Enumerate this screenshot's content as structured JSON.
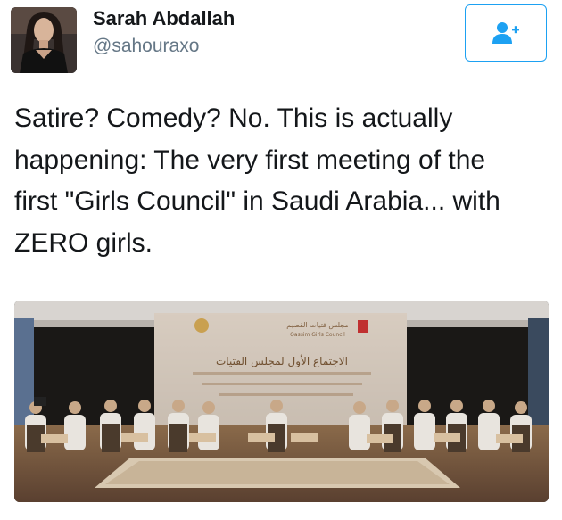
{
  "tweet": {
    "author_name": "Sarah Abdallah",
    "author_handle": "@sahouraxo",
    "text_lines": [
      "Satire? Comedy? No. This is actually",
      "happening: The very first meeting of the",
      "first \"Girls Council\" in Saudi Arabia... with",
      "ZERO girls."
    ]
  },
  "follow_button": {
    "icon": "add-user-icon"
  },
  "photo": {
    "banner_title": "الاجتماع الأول لمجلس الفتيات",
    "banner_logo_arabic": "مجلس فتيات القصيم",
    "banner_logo_english": "Qassim Girls Council"
  },
  "colors": {
    "accent": "#1da1f2",
    "text_primary": "#14171a",
    "text_secondary": "#657786"
  }
}
